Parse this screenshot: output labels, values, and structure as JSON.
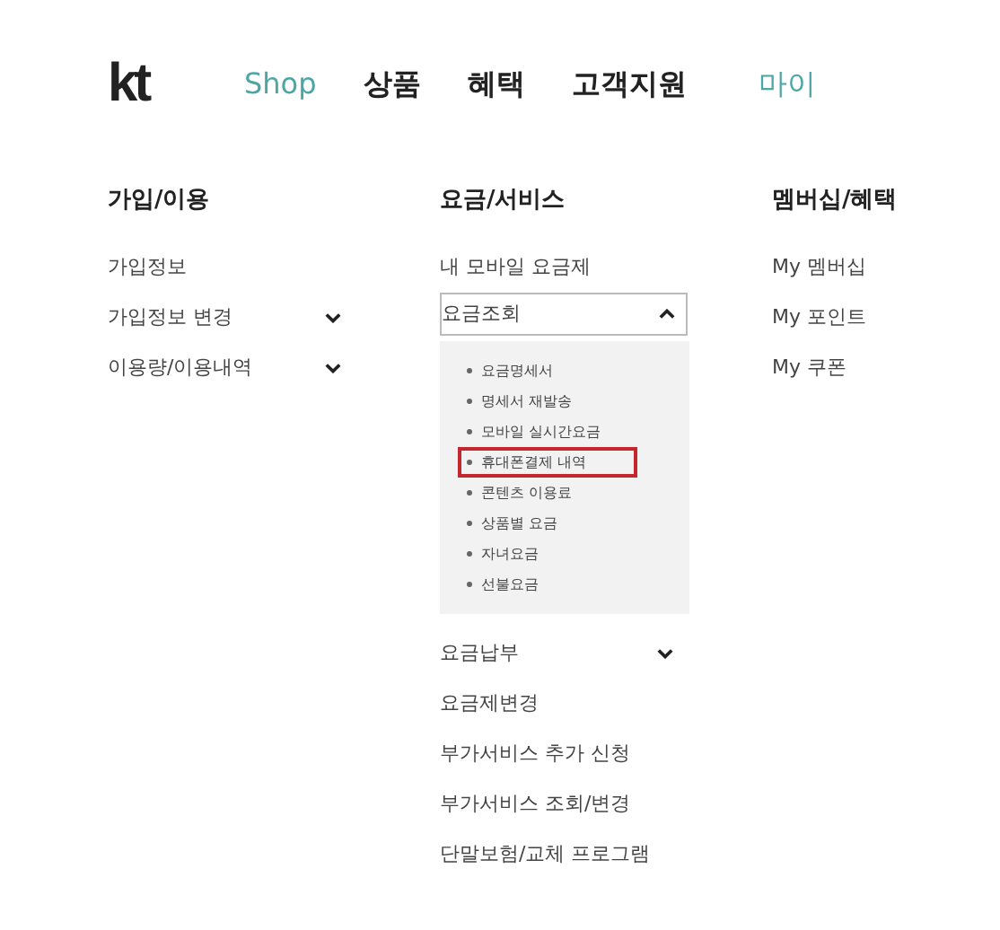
{
  "header": {
    "logo": "kt",
    "nav": [
      {
        "label": "Shop",
        "highlighted": true
      },
      {
        "label": "상품",
        "highlighted": false
      },
      {
        "label": "혜택",
        "highlighted": false
      },
      {
        "label": "고객지원",
        "highlighted": false
      },
      {
        "label": "마이",
        "highlighted": true
      }
    ]
  },
  "columns": [
    {
      "heading": "가입/이용",
      "items": [
        {
          "kind": "link",
          "label": "가입정보"
        },
        {
          "kind": "toggle",
          "label": "가입정보 변경",
          "expanded": false
        },
        {
          "kind": "toggle",
          "label": "이용량/이용내역",
          "expanded": false
        }
      ]
    },
    {
      "heading": "요금/서비스",
      "items": [
        {
          "kind": "link",
          "label": "내 모바일 요금제"
        },
        {
          "kind": "toggle",
          "label": "요금조회",
          "expanded": true,
          "children": [
            {
              "label": "요금명세서",
              "highlighted": false
            },
            {
              "label": "명세서 재발송",
              "highlighted": false
            },
            {
              "label": "모바일 실시간요금",
              "highlighted": false
            },
            {
              "label": "휴대폰결제 내역",
              "highlighted": true
            },
            {
              "label": "콘텐츠 이용료",
              "highlighted": false
            },
            {
              "label": "상품별 요금",
              "highlighted": false
            },
            {
              "label": "자녀요금",
              "highlighted": false
            },
            {
              "label": "선불요금",
              "highlighted": false
            }
          ]
        },
        {
          "kind": "toggle",
          "label": "요금납부",
          "expanded": false
        },
        {
          "kind": "link",
          "label": "요금제변경"
        },
        {
          "kind": "link",
          "label": "부가서비스 추가 신청"
        },
        {
          "kind": "link",
          "label": "부가서비스 조회/변경"
        },
        {
          "kind": "link",
          "label": "단말보험/교체 프로그램"
        }
      ]
    },
    {
      "heading": "멤버십/혜택",
      "items": [
        {
          "kind": "link",
          "label": "My 멤버십"
        },
        {
          "kind": "link",
          "label": "My 포인트"
        },
        {
          "kind": "link",
          "label": "My 쿠폰"
        }
      ]
    }
  ]
}
